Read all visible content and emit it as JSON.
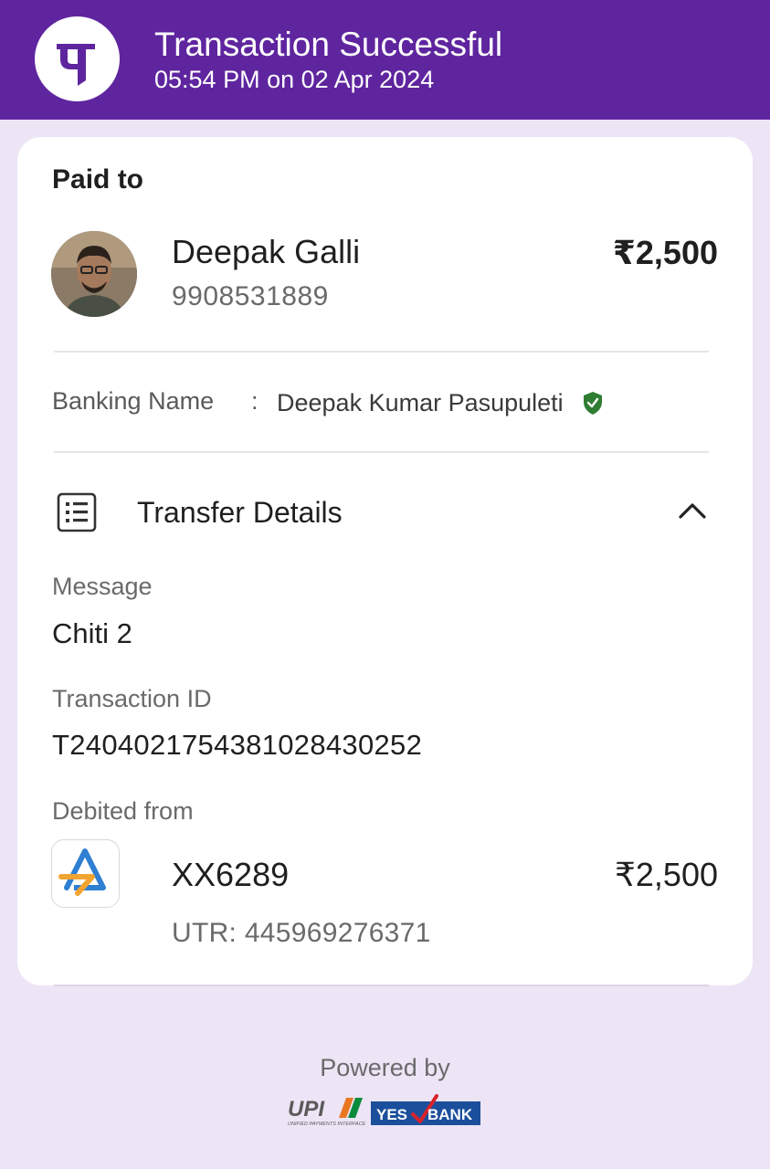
{
  "header": {
    "status_title": "Transaction Successful",
    "timestamp": "05:54 PM on 02 Apr 2024",
    "logo_icon": "phonepe-logo-icon",
    "brand_color": "#5f259f"
  },
  "payment": {
    "paid_to_label": "Paid to",
    "payee_name": "Deepak Galli",
    "payee_phone": "9908531889",
    "amount": "₹2,500",
    "avatar_icon": "payee-avatar"
  },
  "banking": {
    "label": "Banking Name",
    "separator": ":",
    "value": "Deepak Kumar Pasupuleti",
    "verified_icon": "verified-shield-icon",
    "verified_color": "#2e7d32"
  },
  "transfer_details": {
    "title": "Transfer Details",
    "doc_icon": "receipt-list-icon",
    "toggle_icon": "chevron-up-icon",
    "message_label": "Message",
    "message_value": "Chiti 2",
    "transaction_id_label": "Transaction ID",
    "transaction_id_value": "T2404021754381028430252",
    "debited_from_label": "Debited from",
    "bank_icon": "sbi-bank-icon",
    "account": "XX6289",
    "debited_amount": "₹2,500",
    "utr": "UTR: 445969276371"
  },
  "footer": {
    "powered_by": "Powered by",
    "upi_logo_text": "UPI",
    "upi_tagline": "UNIFIED PAYMENTS INTERFACE",
    "bank_logo_text_left": "YES",
    "bank_logo_text_right": "BANK"
  }
}
